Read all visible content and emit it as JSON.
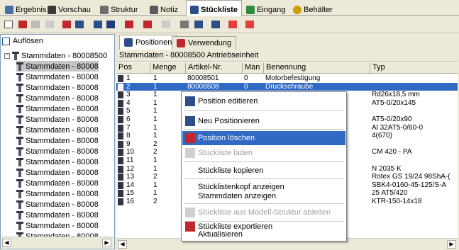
{
  "top_tabs": [
    {
      "label": "Ergebnis",
      "icon": "table-icon",
      "color": "#4a6fa5"
    },
    {
      "label": "Vorschau",
      "icon": "preview-icon",
      "color": "#3a3a3a"
    },
    {
      "label": "Struktur",
      "icon": "structure-icon",
      "color": "#6d6d6d"
    },
    {
      "label": "Notiz",
      "icon": "note-icon",
      "color": "#5a5a5a"
    },
    {
      "label": "Stückliste",
      "icon": "bom-icon",
      "color": "#2c4f8a",
      "active": true
    },
    {
      "label": "Eingang",
      "icon": "input-icon",
      "color": "#2e8b3e"
    },
    {
      "label": "Behälter",
      "icon": "container-icon",
      "color": "#c8a000"
    }
  ],
  "left_panel": {
    "aufloesen_label": "Auflösen",
    "root_label": "Stammdaten - 80008500",
    "children": [
      "Stammdaten - 80008",
      "Stammdaten - 80008",
      "Stammdaten - 80008",
      "Stammdaten - 80008",
      "Stammdaten - 80008",
      "Stammdaten - 80008",
      "Stammdaten - 80008",
      "Stammdaten - 80008",
      "Stammdaten - 80008",
      "Stammdaten - 80008",
      "Stammdaten - 80008",
      "Stammdaten - 80008",
      "Stammdaten - 80008",
      "Stammdaten - 80008",
      "Stammdaten - 80008",
      "Stammdaten - 80008",
      "Stammdaten - 80008"
    ]
  },
  "right_panel": {
    "tab_positionen": "Positionen",
    "tab_verwendung": "Verwendung",
    "header_text": "Stammdaten - 80008500 Antriebseinheit",
    "columns": [
      "Pos",
      "Menge",
      "Artikel-Nr.",
      "Man",
      "Benennung",
      "Typ"
    ],
    "rows": [
      {
        "pos": "1",
        "menge": "1",
        "artikel": "80008501",
        "man": "0",
        "benennung": "Motorbefestigung",
        "typ": ""
      },
      {
        "pos": "2",
        "menge": "1",
        "artikel": "80008508",
        "man": "0",
        "benennung": "Druckschraube",
        "typ": ""
      },
      {
        "pos": "3",
        "menge": "1",
        "artikel": "",
        "man": "",
        "benennung": "",
        "typ": "Rd26x18,5 mm"
      },
      {
        "pos": "4",
        "menge": "1",
        "artikel": "",
        "man": "",
        "benennung": "",
        "typ": "AT5-0/20x145"
      },
      {
        "pos": "5",
        "menge": "1",
        "artikel": "",
        "man": "",
        "benennung": "",
        "typ": ""
      },
      {
        "pos": "6",
        "menge": "1",
        "artikel": "",
        "man": "",
        "benennung": "",
        "typ": "AT5-0/20x90"
      },
      {
        "pos": "7",
        "menge": "1",
        "artikel": "",
        "man": "",
        "benennung": "",
        "typ": "Al 32AT5-0/60-0"
      },
      {
        "pos": "8",
        "menge": "1",
        "artikel": "",
        "man": "",
        "benennung": "",
        "typ": "4(670)"
      },
      {
        "pos": "9",
        "menge": "2",
        "artikel": "",
        "man": "",
        "benennung": "m",
        "typ": ""
      },
      {
        "pos": "10",
        "menge": "2",
        "artikel": "",
        "man": "",
        "benennung": "",
        "typ": "CM 420 - PA"
      },
      {
        "pos": "11",
        "menge": "1",
        "artikel": "",
        "man": "",
        "benennung": "",
        "typ": ""
      },
      {
        "pos": "12",
        "menge": "1",
        "artikel": "",
        "man": "",
        "benennung": "",
        "typ": "N 2035 K"
      },
      {
        "pos": "13",
        "menge": "2",
        "artikel": "",
        "man": "",
        "benennung": "",
        "typ": "Rotex GS 19/24 98ShA-("
      },
      {
        "pos": "14",
        "menge": "1",
        "artikel": "",
        "man": "",
        "benennung": "",
        "typ": "SBK4-0160-45-125/S-A"
      },
      {
        "pos": "15",
        "menge": "1",
        "artikel": "",
        "man": "",
        "benennung": "",
        "typ": "25 AT5/420"
      },
      {
        "pos": "16",
        "menge": "2",
        "artikel": "",
        "man": "",
        "benennung": "",
        "typ": "KTR-150-14x18"
      }
    ]
  },
  "context_menu": [
    {
      "label": "Position editieren",
      "enabled": true,
      "icon": "edit-icon"
    },
    {
      "label": "Neu Positionieren",
      "enabled": true,
      "icon": "new-position-icon"
    },
    {
      "label": "Position löschen",
      "enabled": true,
      "icon": "delete-position-icon",
      "highlighted": true
    },
    {
      "label": "Stückliste laden",
      "enabled": false,
      "icon": "load-icon"
    },
    {
      "label": "Stückliste kopieren",
      "enabled": true
    },
    {
      "label": "Stücklistenkopf anzeigen",
      "enabled": true
    },
    {
      "label": "Stammdaten anzeigen",
      "enabled": true
    },
    {
      "label": "Stückliste aus Modell-Struktur ableiten",
      "enabled": false,
      "icon": "derive-icon"
    },
    {
      "label": "Stückliste exportieren",
      "enabled": true,
      "icon": "export-icon"
    },
    {
      "label": "Aktualisieren",
      "enabled": true
    }
  ]
}
